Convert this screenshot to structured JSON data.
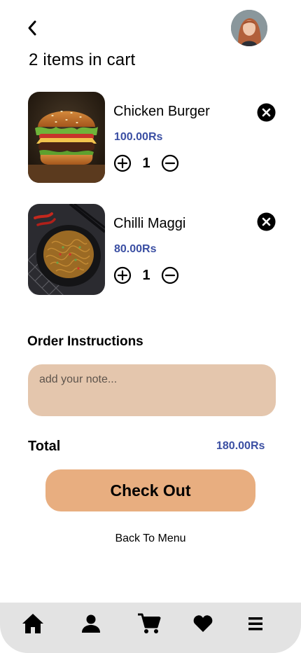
{
  "header": {
    "back_icon": "chevron-left-icon",
    "avatar_icon": "user-avatar"
  },
  "cart": {
    "title": "2 items in cart",
    "items": [
      {
        "name": "Chicken Burger",
        "price": "100.00Rs",
        "quantity": "1",
        "image": "burger-image"
      },
      {
        "name": "Chilli Maggi",
        "price": "80.00Rs",
        "quantity": "1",
        "image": "noodles-image"
      }
    ]
  },
  "instructions": {
    "label": "Order Instructions",
    "placeholder": "add your note..."
  },
  "summary": {
    "total_label": "Total",
    "total_value": "180.00Rs"
  },
  "actions": {
    "checkout_label": "Check Out",
    "back_to_menu_label": "Back To Menu"
  },
  "nav": {
    "items": [
      "home-icon",
      "profile-icon",
      "cart-icon",
      "favorites-icon",
      "menu-icon"
    ]
  },
  "colors": {
    "price": "#3b4fa3",
    "checkout_bg": "#e8ae80",
    "note_bg": "#e4c6ad",
    "nav_bg": "#e3e3e3"
  }
}
